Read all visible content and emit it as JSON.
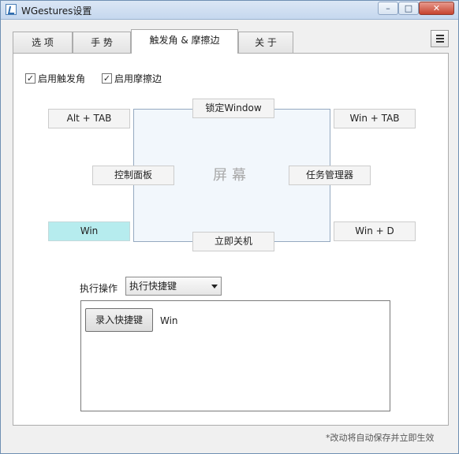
{
  "window": {
    "title": "WGestures设置",
    "controls": {
      "minimize": "–",
      "maximize": "□",
      "close": "✕"
    }
  },
  "tabs": [
    {
      "label": "选 项",
      "active": false
    },
    {
      "label": "手 势",
      "active": false
    },
    {
      "label": "触发角 & 摩擦边",
      "active": true
    },
    {
      "label": "关 于",
      "active": false
    }
  ],
  "menu_icon": "hamburger-icon",
  "options": {
    "enable_corners": {
      "label": "启用触发角",
      "checked": true
    },
    "enable_edges": {
      "label": "启用摩擦边",
      "checked": true
    }
  },
  "screen_label": "屏幕",
  "slots": {
    "top_left": "Alt + TAB",
    "top_edge": "锁定Window",
    "top_right": "Win + TAB",
    "left_edge": "控制面板",
    "right_edge": "任务管理器",
    "bottom_left": "Win",
    "bottom_edge": "立即关机",
    "bottom_right": "Win + D"
  },
  "selected_slot": "bottom_left",
  "colors": {
    "selected_slot": "#b6ecee",
    "screen_fill": "#f2f7fc"
  },
  "action": {
    "label": "执行操作",
    "selected": "执行快捷键",
    "record_button": "录入快捷键",
    "shortcut_value": "Win"
  },
  "footer_note": "*改动将自动保存并立即生效"
}
